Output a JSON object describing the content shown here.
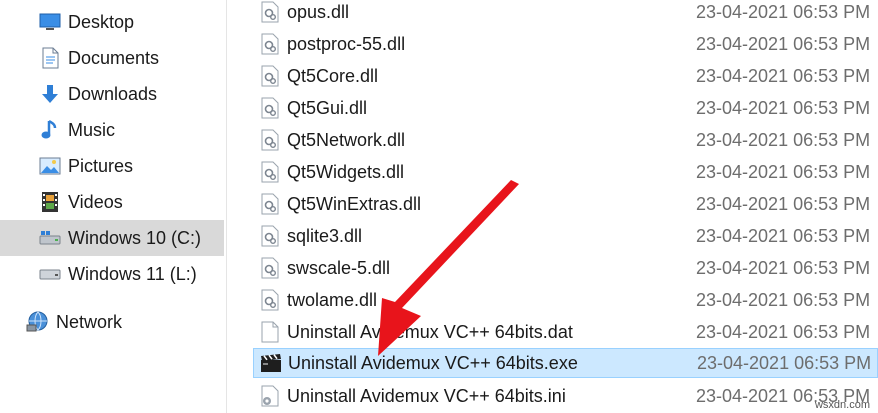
{
  "sidebar": {
    "items": [
      {
        "label": "Desktop",
        "icon": "desktop-icon"
      },
      {
        "label": "Documents",
        "icon": "documents-icon"
      },
      {
        "label": "Downloads",
        "icon": "downloads-icon"
      },
      {
        "label": "Music",
        "icon": "music-icon"
      },
      {
        "label": "Pictures",
        "icon": "pictures-icon"
      },
      {
        "label": "Videos",
        "icon": "videos-icon"
      },
      {
        "label": "Windows 10 (C:)",
        "icon": "drive-c-icon",
        "selected": true
      },
      {
        "label": "Windows 11 (L:)",
        "icon": "drive-l-icon"
      },
      {
        "label": "Network",
        "icon": "network-icon"
      }
    ]
  },
  "files": [
    {
      "name": "opus.dll",
      "date": "23-04-2021 06:53 PM",
      "icon": "dll-icon"
    },
    {
      "name": "postproc-55.dll",
      "date": "23-04-2021 06:53 PM",
      "icon": "dll-icon"
    },
    {
      "name": "Qt5Core.dll",
      "date": "23-04-2021 06:53 PM",
      "icon": "dll-icon"
    },
    {
      "name": "Qt5Gui.dll",
      "date": "23-04-2021 06:53 PM",
      "icon": "dll-icon"
    },
    {
      "name": "Qt5Network.dll",
      "date": "23-04-2021 06:53 PM",
      "icon": "dll-icon"
    },
    {
      "name": "Qt5Widgets.dll",
      "date": "23-04-2021 06:53 PM",
      "icon": "dll-icon"
    },
    {
      "name": "Qt5WinExtras.dll",
      "date": "23-04-2021 06:53 PM",
      "icon": "dll-icon"
    },
    {
      "name": "sqlite3.dll",
      "date": "23-04-2021 06:53 PM",
      "icon": "dll-icon"
    },
    {
      "name": "swscale-5.dll",
      "date": "23-04-2021 06:53 PM",
      "icon": "dll-icon"
    },
    {
      "name": "twolame.dll",
      "date": "23-04-2021 06:53 PM",
      "icon": "dll-icon"
    },
    {
      "name": "Uninstall Avidemux VC++ 64bits.dat",
      "date": "23-04-2021 06:53 PM",
      "icon": "dat-file-icon"
    },
    {
      "name": "Uninstall Avidemux VC++ 64bits.exe",
      "date": "23-04-2021 06:53 PM",
      "icon": "clapperboard-icon",
      "selected": true
    },
    {
      "name": "Uninstall Avidemux VC++ 64bits.ini",
      "date": "23-04-2021 06:53 PM",
      "icon": "ini-settings-icon"
    }
  ],
  "annotation": {
    "arrow_color": "#e8141b",
    "points_to": "Uninstall Avidemux VC++ 64bits.exe"
  },
  "watermark": "wsxdn.com"
}
